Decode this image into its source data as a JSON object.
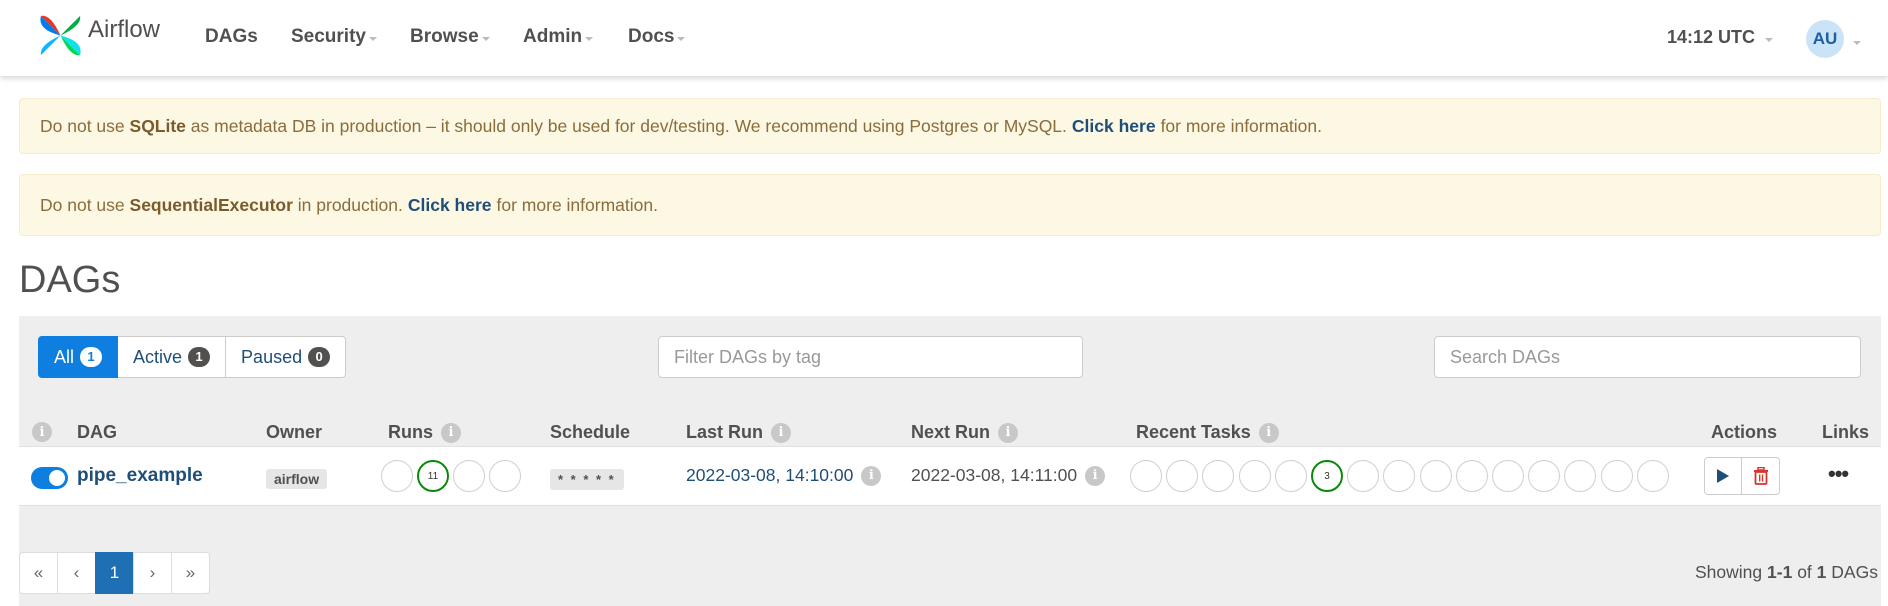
{
  "app": {
    "brand": "Airflow"
  },
  "nav": {
    "items": [
      "DAGs",
      "Security",
      "Browse",
      "Admin",
      "Docs"
    ],
    "clock": "14:12 UTC",
    "user_initials": "AU"
  },
  "alerts": {
    "sqlite": {
      "pre": "Do not use",
      "bold": "SQLite",
      "mid": "as metadata DB in production – it should only be used for dev/testing. We recommend using Postgres or MySQL.",
      "link": "Click here",
      "post": "for more information."
    },
    "executor": {
      "pre": "Do not use",
      "bold": "SequentialExecutor",
      "mid": "in production.",
      "link": "Click here",
      "post": "for more information."
    }
  },
  "page_title": "DAGs",
  "filters": [
    {
      "label": "All",
      "count": "1",
      "active": true
    },
    {
      "label": "Active",
      "count": "1",
      "active": false
    },
    {
      "label": "Paused",
      "count": "0",
      "active": false
    }
  ],
  "tag_filter_placeholder": "Filter DAGs by tag",
  "search_placeholder": "Search DAGs",
  "columns": {
    "info": "i",
    "dag": "DAG",
    "owner": "Owner",
    "runs": "Runs",
    "schedule": "Schedule",
    "last_run": "Last Run",
    "next_run": "Next Run",
    "recent_tasks": "Recent Tasks",
    "actions": "Actions",
    "links": "Links"
  },
  "dags": [
    {
      "name": "pipe_example",
      "owner": "airflow",
      "runs": [
        "",
        "11",
        "",
        ""
      ],
      "schedule": "* * * * *",
      "last_run": "2022-03-08, 14:10:00",
      "next_run": "2022-03-08, 14:11:00",
      "recent_tasks": [
        "",
        "",
        "",
        "",
        "",
        "3",
        "",
        "",
        "",
        "",
        "",
        "",
        "",
        "",
        ""
      ],
      "paused": false
    }
  ],
  "pagination": {
    "first": "«",
    "prev": "‹",
    "current": "1",
    "next": "›",
    "last": "»"
  },
  "showing": {
    "pre": "Showing",
    "range": "1-1",
    "of": "of",
    "total": "1",
    "unit": "DAGs"
  },
  "colors": {
    "primary": "#0e7fe0",
    "link": "#1f4e79",
    "success": "#0a8a0a",
    "danger": "#d9342b",
    "alert_bg": "#fcf8e4"
  }
}
